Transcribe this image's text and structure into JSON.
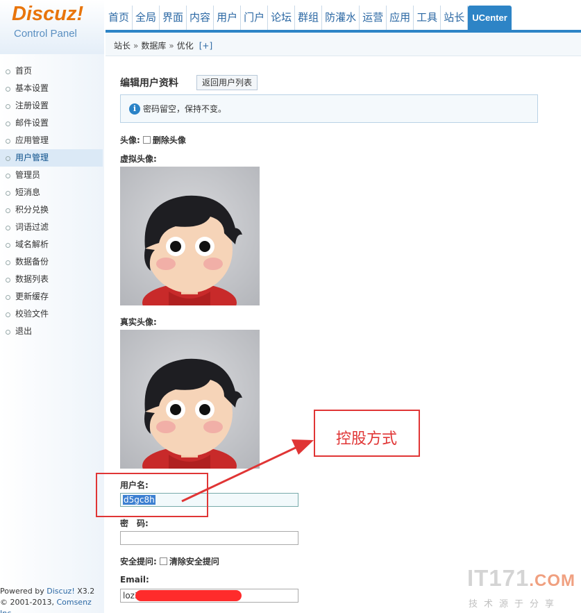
{
  "logo": {
    "main": "Discuz!",
    "sub": "Control Panel"
  },
  "nav": [
    {
      "label": "首页"
    },
    {
      "label": "全局"
    },
    {
      "label": "界面"
    },
    {
      "label": "内容"
    },
    {
      "label": "用户"
    },
    {
      "label": "门户"
    },
    {
      "label": "论坛"
    },
    {
      "label": "群组"
    },
    {
      "label": "防灌水"
    },
    {
      "label": "运营"
    },
    {
      "label": "应用"
    },
    {
      "label": "工具"
    },
    {
      "label": "站长"
    },
    {
      "label": "UCenter"
    }
  ],
  "breadcrumb": {
    "items": [
      "站长",
      "数据库",
      "优化"
    ],
    "separator": "»",
    "plus": "[+]"
  },
  "sidebar": {
    "items": [
      {
        "label": "首页"
      },
      {
        "label": "基本设置"
      },
      {
        "label": "注册设置"
      },
      {
        "label": "邮件设置"
      },
      {
        "label": "应用管理"
      },
      {
        "label": "用户管理"
      },
      {
        "label": "管理员"
      },
      {
        "label": "短消息"
      },
      {
        "label": "积分兑换"
      },
      {
        "label": "词语过滤"
      },
      {
        "label": "域名解析"
      },
      {
        "label": "数据备份"
      },
      {
        "label": "数据列表"
      },
      {
        "label": "更新缓存"
      },
      {
        "label": "校验文件"
      },
      {
        "label": "退出"
      }
    ],
    "footer": {
      "powered": "Powered by",
      "brand": "Discuz!",
      "version": "X3.2",
      "copy": "© 2001-2013,",
      "company": "Comsenz Inc."
    }
  },
  "main": {
    "title": "编辑用户资料",
    "back_button": "返回用户列表",
    "tip": "密码留空，保持不变。",
    "avatar_label": "头像:",
    "delete_avatar": "删除头像",
    "virtual_avatar": "虚拟头像:",
    "real_avatar": "真实头像:",
    "username_label": "用户名:",
    "username_value": "d5gc8h",
    "password_label": "密　码:",
    "security_label": "安全提问:",
    "clear_security": "清除安全提问",
    "email_label": "Email:",
    "email_value": "loz3"
  },
  "annotation": {
    "text": "控股方式"
  },
  "watermark": {
    "main": "IT171",
    "dot": ".COM",
    "sub": "技术源于分享"
  },
  "colors": {
    "accent": "#2d84c6",
    "annotation": "#e03535",
    "logo": "#e8750c"
  }
}
